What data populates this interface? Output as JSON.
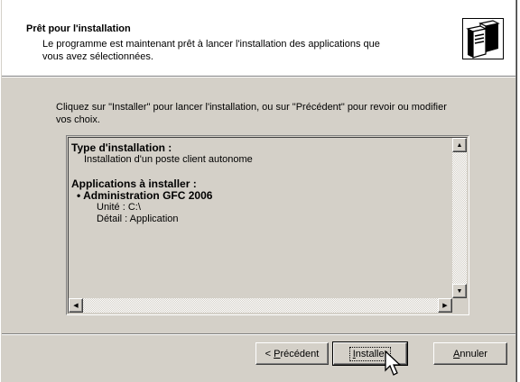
{
  "header": {
    "title": "Prêt pour l'installation",
    "description": "Le programme est maintenant prêt à lancer l'installation des applications que vous avez sélectionnées.",
    "icon": "computer-tower-icon"
  },
  "intro": "Cliquez sur \"Installer\" pour lancer l'installation, ou sur \"Précédent\" pour revoir ou modifier vos choix.",
  "summary": {
    "install_type_heading": "Type d'installation :",
    "install_type_value": "Installation d'un poste client autonome",
    "apps_heading": "Applications à installer :",
    "apps": [
      {
        "name": "Administration GFC 2006",
        "unit": "Unité : C:\\",
        "detail": "Détail : Application"
      }
    ]
  },
  "buttons": {
    "back": {
      "prefix": "< ",
      "mnemonic": "P",
      "rest": "récédent"
    },
    "install": {
      "mnemonic": "I",
      "rest": "nstaller"
    },
    "cancel": {
      "mnemonic": "A",
      "rest": "nnuler"
    }
  },
  "colors": {
    "face": "#d4d0c8",
    "shadow": "#808080",
    "highlight": "#ffffff"
  }
}
